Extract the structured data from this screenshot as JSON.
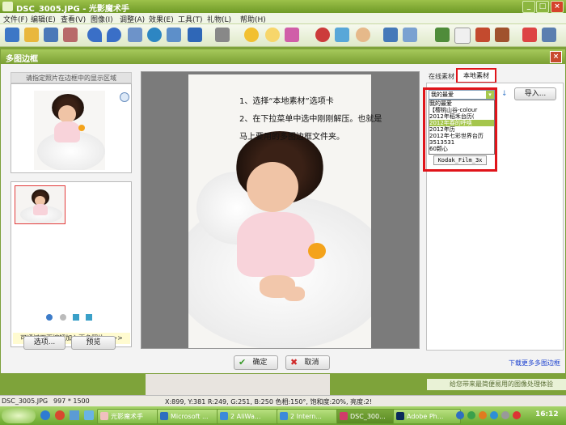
{
  "window": {
    "title": "DSC_3005.JPG - 光影魔术手"
  },
  "menu": [
    "文件(F)",
    "编辑(E)",
    "查看(V)",
    "图像(I)",
    "调整(A)",
    "效果(E)",
    "工具(T)",
    "礼物(L)",
    "帮助(H)"
  ],
  "dialog": {
    "title": "多图边框",
    "left_header": "请指定照片在边框中的显示区域",
    "add_more_hint": "可通过下面按钮加入更多照片 >>>",
    "options_button": "选项...",
    "preview_button": "预览",
    "annotation": {
      "line1": "1、选择“本地素材”选项卡",
      "line2": "2、在下拉菜单中选中刚刚解压。也就是",
      "line3": "马上要用的多图边框文件夹。"
    },
    "tabs": {
      "online": "在线素材",
      "local": "本地素材"
    },
    "dropdown": {
      "selected": "我的最爱",
      "options": [
        "我的最爱",
        "【樱桃山谷-colour",
        "2012年稻禾台历(",
        "2012年春的呼唤",
        "2012年历",
        "2012年七彩世界台历",
        "3513531",
        "60颗心"
      ]
    },
    "thumb_caption": "Kodak_Film_3x",
    "import_button": "导入...",
    "ok_button": "确定",
    "cancel_button": "取消",
    "download_link": "下载更多多图边框"
  },
  "banner_text": "给您带来最简便易用的图像处理体验",
  "statusbar": {
    "filename": "DSC_3005.JPG",
    "dimensions": "997 * 1500",
    "pixel_info": "X:899, Y:381 R:249, G:251, B:250 色相:150°, 饱和度:20%, 亮度:2!"
  },
  "taskbar": {
    "items": [
      "光影魔术手",
      "Microsoft ...",
      "2 AliWa...",
      "2 Intern...",
      "DSC_300...",
      "Adobe Ph..."
    ],
    "clock": "16:12"
  },
  "colors": {
    "accent_green": "#7ba034",
    "highlight_red": "#e0141a",
    "link_blue": "#1a3fcf"
  }
}
